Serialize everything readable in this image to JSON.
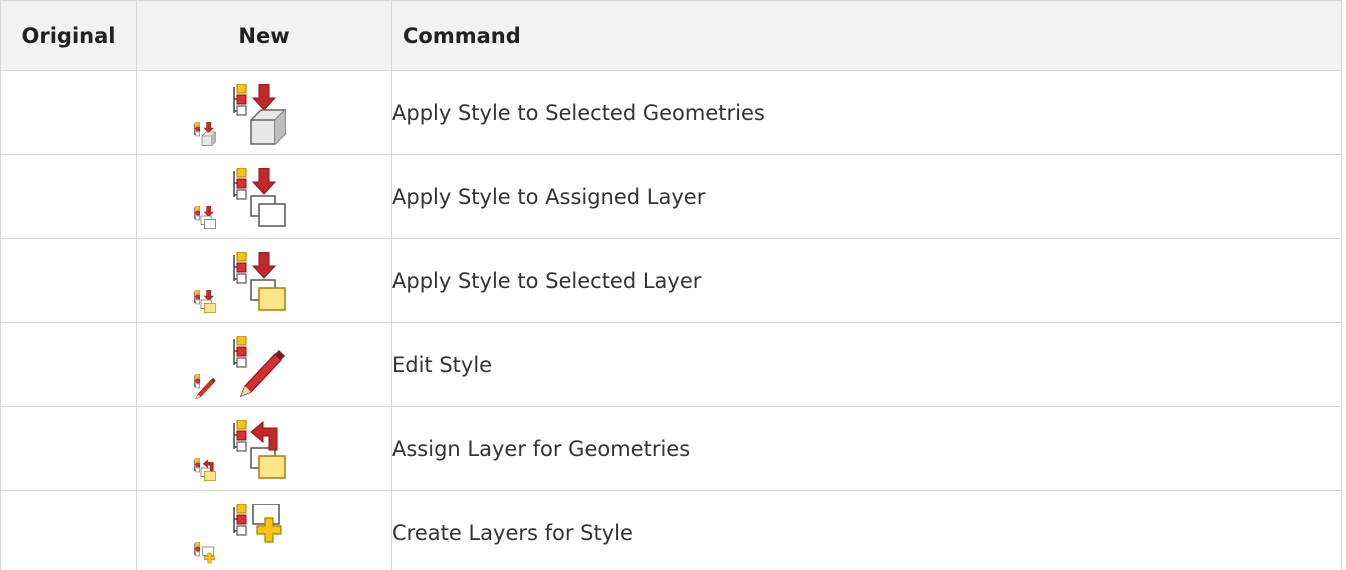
{
  "table": {
    "headers": {
      "original": "Original",
      "new": "New",
      "command": "Command"
    },
    "rows": [
      {
        "command": "Apply Style to Selected Geometries",
        "icon": "apply-style-selected-geometries-icon"
      },
      {
        "command": "Apply Style to Assigned Layer",
        "icon": "apply-style-assigned-layer-icon"
      },
      {
        "command": "Apply Style to Selected Layer",
        "icon": "apply-style-selected-layer-icon"
      },
      {
        "command": "Edit Style",
        "icon": "edit-style-icon"
      },
      {
        "command": "Assign Layer for Geometries",
        "icon": "assign-layer-geometries-icon"
      },
      {
        "command": "Create Layers for Style",
        "icon": "create-layers-style-icon"
      }
    ]
  },
  "colors": {
    "yellow": "#f8c515",
    "red": "#d83030",
    "dark_red": "#b32222",
    "gray": "#7a7a7a",
    "light_yellow": "#fde58a",
    "grid": "#d6d6d6",
    "header_bg": "#f2f2f2"
  }
}
